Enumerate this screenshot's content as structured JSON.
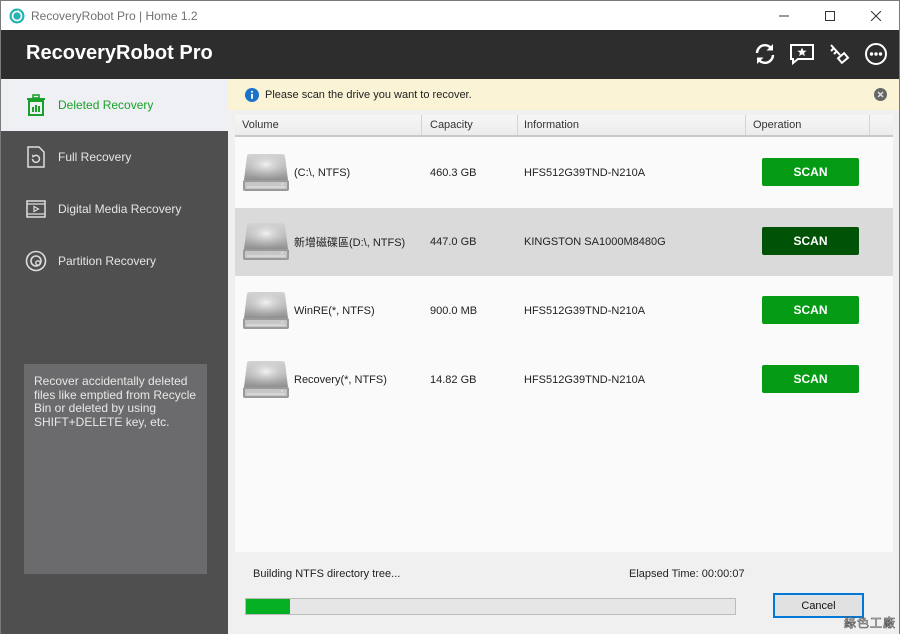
{
  "window": {
    "title": "RecoveryRobot Pro | Home 1.2",
    "controls": {
      "minimize": "—",
      "maximize": "☐",
      "close": "✕"
    }
  },
  "header": {
    "brand": "RecoveryRobot Pro",
    "icons": [
      "refresh-icon",
      "feedback-star-icon",
      "key-icon",
      "more-icon"
    ]
  },
  "sidebar": {
    "items": [
      {
        "label": "Deleted Recovery",
        "icon": "trash-icon",
        "active": true
      },
      {
        "label": "Full Recovery",
        "icon": "file-restore-icon",
        "active": false
      },
      {
        "label": "Digital Media Recovery",
        "icon": "media-icon",
        "active": false
      },
      {
        "label": "Partition Recovery",
        "icon": "partition-icon",
        "active": false
      }
    ],
    "description": "Recover accidentally deleted files like emptied from Recycle Bin or deleted by using SHIFT+DELETE key, etc."
  },
  "notice": {
    "text": "Please scan the drive you want to recover."
  },
  "table": {
    "columns": [
      "Volume",
      "Capacity",
      "Information",
      "Operation"
    ],
    "rows": [
      {
        "volume": "(C:\\, NTFS)",
        "capacity": "460.3 GB",
        "information": "HFS512G39TND-N210A",
        "operation": "SCAN",
        "selected": false
      },
      {
        "volume": "新增磁碟區(D:\\, NTFS)",
        "capacity": "447.0 GB",
        "information": "KINGSTON SA1000M8480G",
        "operation": "SCAN",
        "selected": true
      },
      {
        "volume": "WinRE(*, NTFS)",
        "capacity": "900.0 MB",
        "information": "HFS512G39TND-N210A",
        "operation": "SCAN",
        "selected": false
      },
      {
        "volume": "Recovery(*, NTFS)",
        "capacity": "14.82 GB",
        "information": "HFS512G39TND-N210A",
        "operation": "SCAN",
        "selected": false
      }
    ]
  },
  "status": {
    "message": "Building NTFS directory tree...",
    "elapsed": "Elapsed Time: 00:00:07",
    "progress_percent": 9,
    "cancel_label": "Cancel"
  },
  "colors": {
    "accent_green": "#069b15",
    "selected_scan": "#005207",
    "header_bg": "#2d2d2d",
    "sidebar_bg": "#4f4f4f"
  },
  "watermark": "綠色工廠"
}
